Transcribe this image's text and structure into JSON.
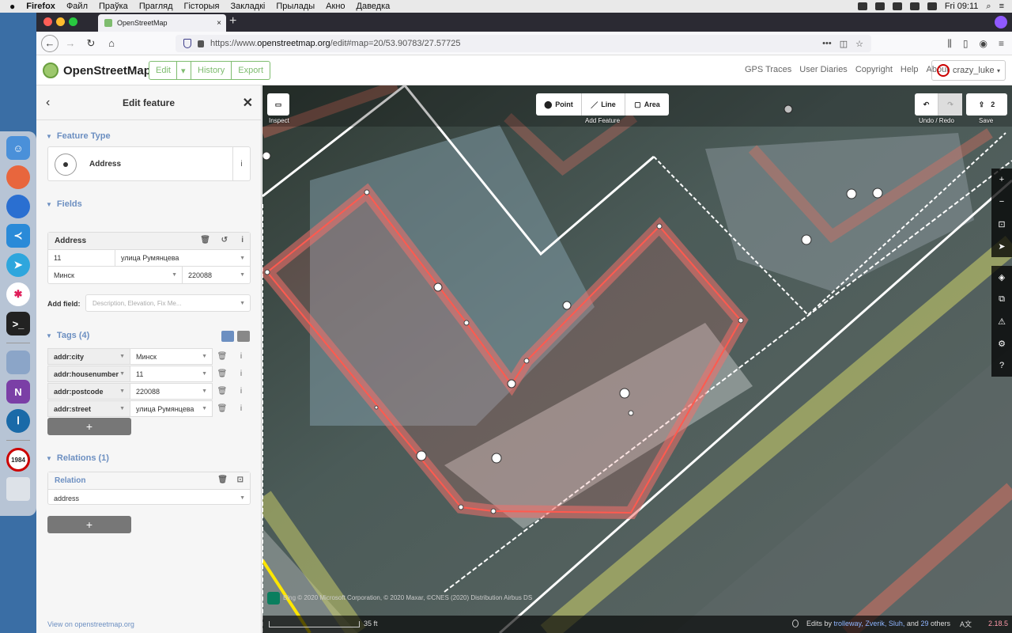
{
  "menubar": {
    "app": "Firefox",
    "items": [
      "Файл",
      "Праўка",
      "Прагляд",
      "Гісторыя",
      "Закладкі",
      "Прылады",
      "Акно",
      "Даведка"
    ],
    "clock": "Fri 09:11"
  },
  "browser": {
    "tab_title": "OpenStreetMap",
    "url_prefix": "https://www.",
    "url_host": "openstreetmap.org",
    "url_path": "/edit#map=20/53.90783/27.57725"
  },
  "osm": {
    "logo": "OpenStreetMap",
    "edit": "Edit",
    "history": "History",
    "export": "Export",
    "links": [
      "GPS Traces",
      "User Diaries",
      "Copyright",
      "Help",
      "About"
    ],
    "user": "crazy_luke"
  },
  "editor": {
    "title": "Edit feature",
    "feature_type_section": "Feature Type",
    "feature_type": "Address",
    "fields_section": "Fields",
    "address_label": "Address",
    "housenumber": "11",
    "street": "улица Румянцева",
    "city": "Минск",
    "postcode": "220088",
    "add_field_label": "Add field:",
    "add_field_placeholder": "Description, Elevation, Fix Me...",
    "tags_section": "Tags (4)",
    "tags": [
      {
        "key": "addr:city",
        "value": "Минск"
      },
      {
        "key": "addr:housenumber",
        "value": "11"
      },
      {
        "key": "addr:postcode",
        "value": "220088"
      },
      {
        "key": "addr:street",
        "value": "улица Румянцева"
      }
    ],
    "relations_section": "Relations (1)",
    "relation_label": "Relation",
    "relation_role": "address",
    "view_link": "View on openstreetmap.org"
  },
  "map": {
    "inspect": "Inspect",
    "point": "Point",
    "line": "Line",
    "area": "Area",
    "add_feature": "Add Feature",
    "undo_redo": "Undo / Redo",
    "save": "Save",
    "save_count": "2",
    "attribution": "Bing © 2020 Microsoft Corporation, © 2020 Maxar, ©CNES (2020) Distribution Airbus DS",
    "scale": "35 ft",
    "edits_by": "Edits by",
    "editors": "trolleway, Zverik, Sluh,",
    "and": "and",
    "others_count": "29",
    "others": "others",
    "version": "2.18.5"
  }
}
